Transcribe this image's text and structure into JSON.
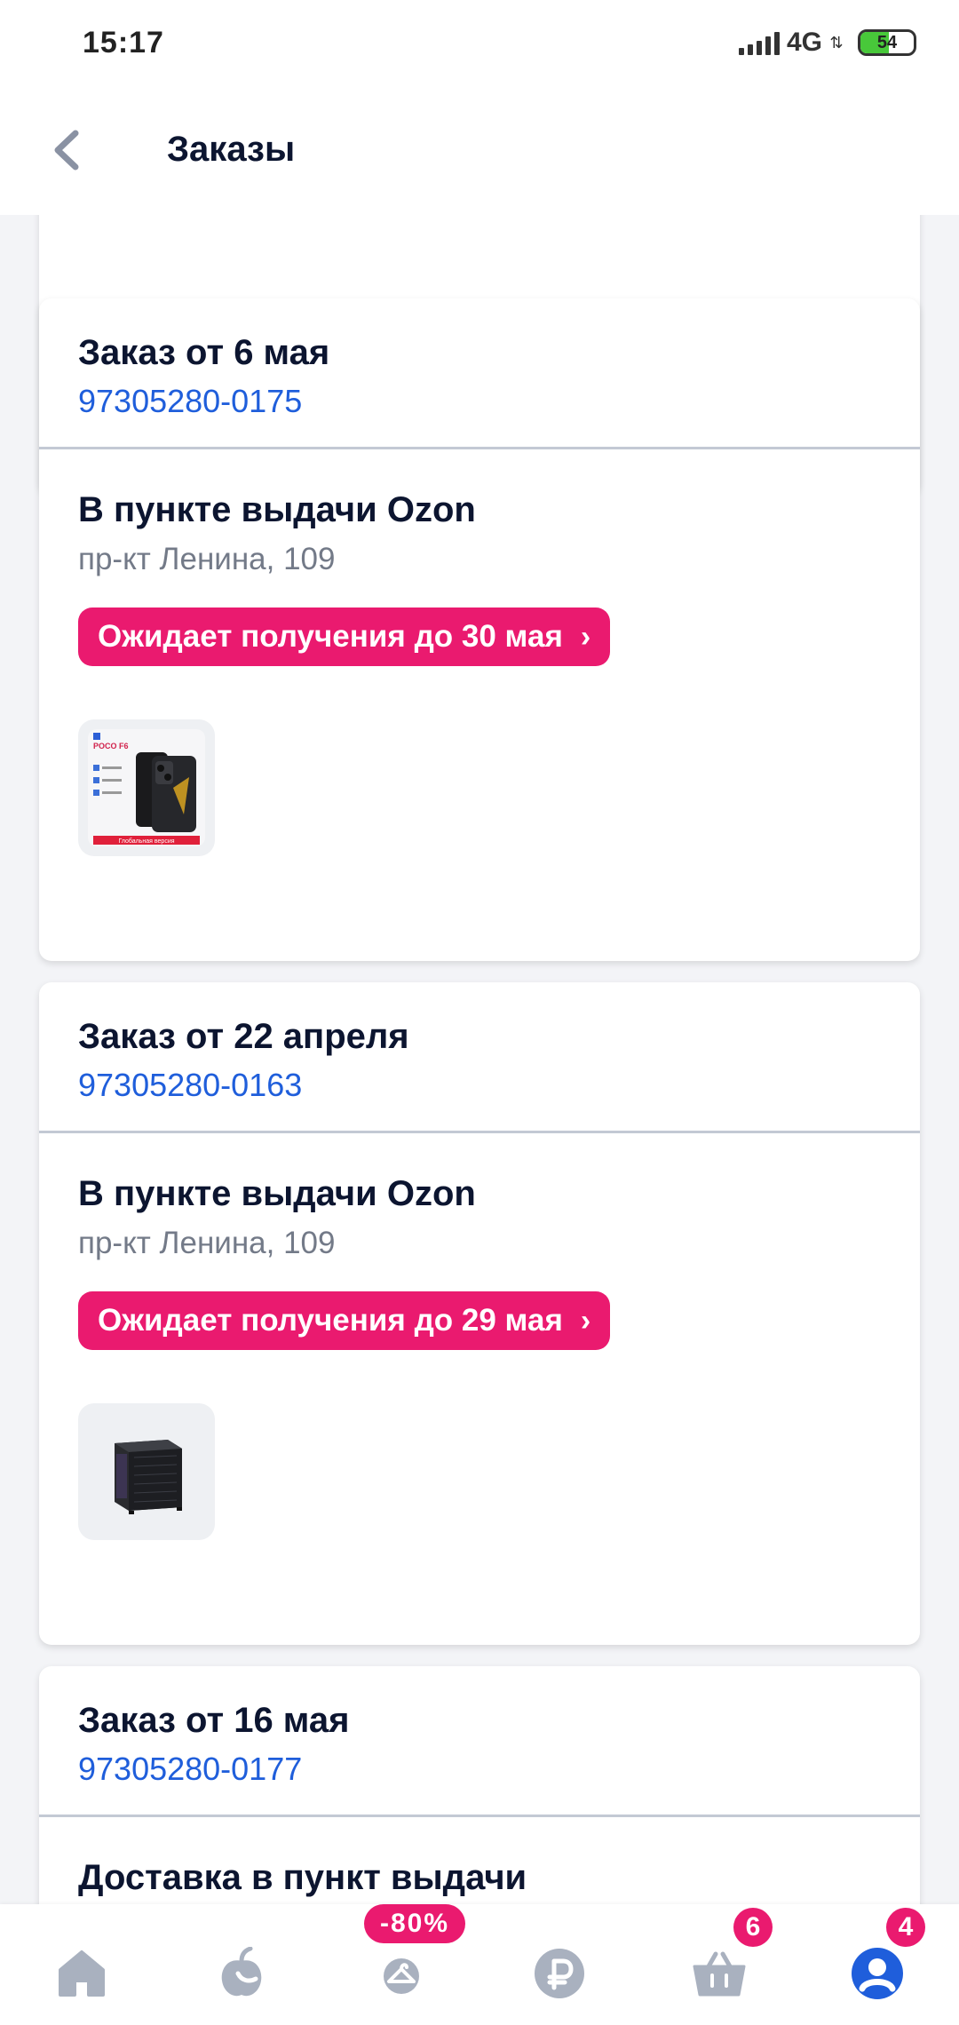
{
  "status_bar": {
    "time": "15:17",
    "network": "4G",
    "battery": "54",
    "battery_level": 0.54
  },
  "header": {
    "title": "Заказы",
    "back_icon": "chevron-left-icon"
  },
  "orders": [
    {
      "title": "Заказ от 6 мая",
      "number": "97305280-0175",
      "delivery_title": "В пункте выдачи Ozon",
      "address": "пр-кт Ленина, 109",
      "status": "Ожидает получения до 30 мая",
      "product_icon": "smartphone-product-image",
      "product_brand": "POCO F6",
      "product_banner": "Глобальная версия"
    },
    {
      "title": "Заказ от 22 апреля",
      "number": "97305280-0163",
      "delivery_title": "В пункте выдачи Ozon",
      "address": "пр-кт Ленина, 109",
      "status": "Ожидает получения до 29 мая",
      "product_icon": "pc-case-product-image"
    },
    {
      "title": "Заказ от 16 мая",
      "number": "97305280-0177",
      "delivery_title": "Доставка в пункт выдачи"
    }
  ],
  "bottom_nav": {
    "items": [
      {
        "name": "home",
        "icon": "home-icon"
      },
      {
        "name": "fresh",
        "icon": "fresh-icon"
      },
      {
        "name": "discounts",
        "icon": "hanger-icon",
        "badge": "-80%"
      },
      {
        "name": "finance",
        "icon": "ruble-icon"
      },
      {
        "name": "cart",
        "icon": "basket-icon",
        "badge": "6"
      },
      {
        "name": "profile",
        "icon": "profile-icon",
        "badge": "4"
      }
    ]
  },
  "colors": {
    "accent": "#ea1a6f",
    "link": "#1f5edb",
    "active_nav": "#1f5edb",
    "inactive_nav": "#a9b1bf"
  }
}
